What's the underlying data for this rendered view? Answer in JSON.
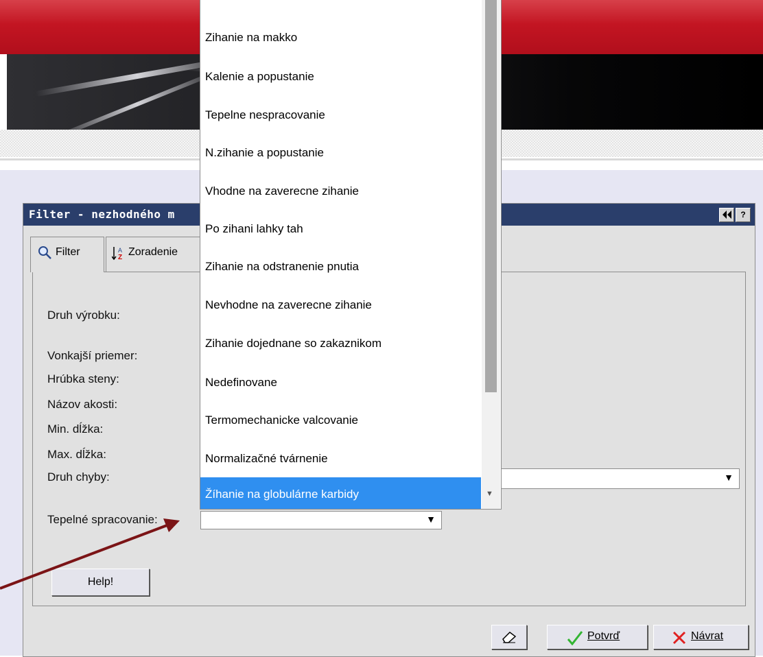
{
  "dialog": {
    "title": "Filter - nezhodného m"
  },
  "tabs": [
    {
      "label": "Filter"
    },
    {
      "label": "Zoradenie"
    }
  ],
  "form": {
    "druh_vyrobku": "Druh výrobku:",
    "vonkajsi_priemer": "Vonkajší priemer:",
    "hrubka_steny": "Hrúbka steny:",
    "nazov_akosti": "Názov akosti:",
    "min_dlzka": "Min. dĺžka:",
    "max_dlzka": "Max. dĺžka:",
    "druh_chyby": "Druh chyby:",
    "tepelne_spracovanie": "Tepelné spracovanie:",
    "tepelne_value": "",
    "druh_chyby_value": ""
  },
  "buttons": {
    "help": "Help!",
    "potvrd": "Potvrď",
    "navrat": "Návrat"
  },
  "dropdown": {
    "items": [
      "Zihanie na makko",
      "Kalenie a popustanie",
      "Tepelne nespracovanie",
      "N.zihanie a popustanie",
      "Vhodne na zaverecne zihanie",
      "Po zihani lahky tah",
      "Zihanie na odstranenie pnutia",
      "Nevhodne na zaverecne zihanie",
      "Zihanie dojednane so zakaznikom",
      "Nedefinovane",
      "Termomechanicke valcovanie",
      "Normalizačné tvárnenie",
      "Žíhanie na globulárne karbidy"
    ],
    "selected_index": 12
  },
  "colors": {
    "titlebar": "#2a3e6b",
    "selection": "#2f8ff0",
    "header_red": "#c31522",
    "annotation_arrow": "#7b1416"
  },
  "icons": {
    "filter_tab": "magnifier-icon",
    "sort_tab": "sort-az-icon",
    "collapse": "double-left-arrow-icon",
    "help": "question-icon",
    "eraser": "eraser-icon",
    "confirm": "checkmark-icon",
    "cancel": "x-icon"
  }
}
